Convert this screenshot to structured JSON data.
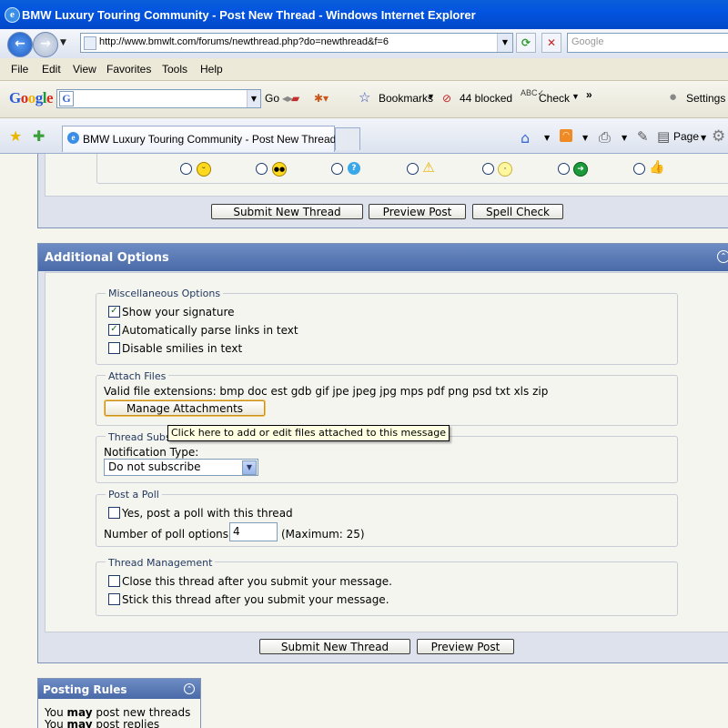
{
  "window": {
    "title": "BMW Luxury Touring Community - Post New Thread - Windows Internet Explorer"
  },
  "address": {
    "url": "http://www.bmwlt.com/forums/newthread.php?do=newthread&f=6",
    "search_placeholder": "Google"
  },
  "menu": [
    "File",
    "Edit",
    "View",
    "Favorites",
    "Tools",
    "Help"
  ],
  "google_toolbar": {
    "logo": "Google",
    "go": "Go",
    "bookmarks": "Bookmarks",
    "blocked": "44 blocked",
    "check": "Check",
    "more": "»",
    "settings": "Settings"
  },
  "tabs": [
    {
      "label": "BMW Luxury Touring Community - Post New Thread"
    }
  ],
  "command_bar": {
    "page": "Page"
  },
  "top_buttons": {
    "submit": "Submit New Thread",
    "preview": "Preview Post",
    "spell": "Spell Check"
  },
  "additional_options": {
    "title": "Additional Options",
    "misc": {
      "legend": "Miscellaneous Options",
      "items": [
        {
          "label": "Show your signature",
          "checked": true
        },
        {
          "label": "Automatically parse links in text",
          "checked": true
        },
        {
          "label": "Disable smilies in text",
          "checked": false
        }
      ]
    },
    "attach": {
      "legend": "Attach Files",
      "valid_text": "Valid file extensions: bmp doc est gdb gif jpe jpeg jpg mps pdf png psd txt xls zip",
      "button": "Manage Attachments",
      "tooltip": "Click here to add or edit files attached to this message"
    },
    "subscription": {
      "legend": "Thread Subsc",
      "notification_label": "Notification Type:",
      "selected": "Do not subscribe"
    },
    "poll": {
      "legend": "Post a Poll",
      "checkbox_label": "Yes, post a poll with this thread",
      "options_label": "Number of poll options:",
      "options_value": "4",
      "max_text": "(Maximum: 25)"
    },
    "management": {
      "legend": "Thread Management",
      "items": [
        {
          "label": "Close this thread after you submit your message.",
          "checked": false
        },
        {
          "label": "Stick this thread after you submit your message.",
          "checked": false
        }
      ]
    }
  },
  "bottom_buttons": {
    "submit": "Submit New Thread",
    "preview": "Preview Post"
  },
  "posting_rules": {
    "title": "Posting Rules",
    "lines": [
      {
        "pre": "You",
        "strong": "may",
        "post": "post new threads"
      },
      {
        "pre": "You",
        "strong": "may",
        "post": "post replies"
      }
    ]
  },
  "icons": {
    "smilies": [
      "smile-icon",
      "cool-icon",
      "question-icon",
      "warning-icon",
      "idea-icon",
      "arrow-icon",
      "thumbs-up-icon"
    ]
  },
  "colors": {
    "header_blue": "#4a6aa8",
    "panel_border": "#7e93b6",
    "legend_text": "#22385e"
  }
}
